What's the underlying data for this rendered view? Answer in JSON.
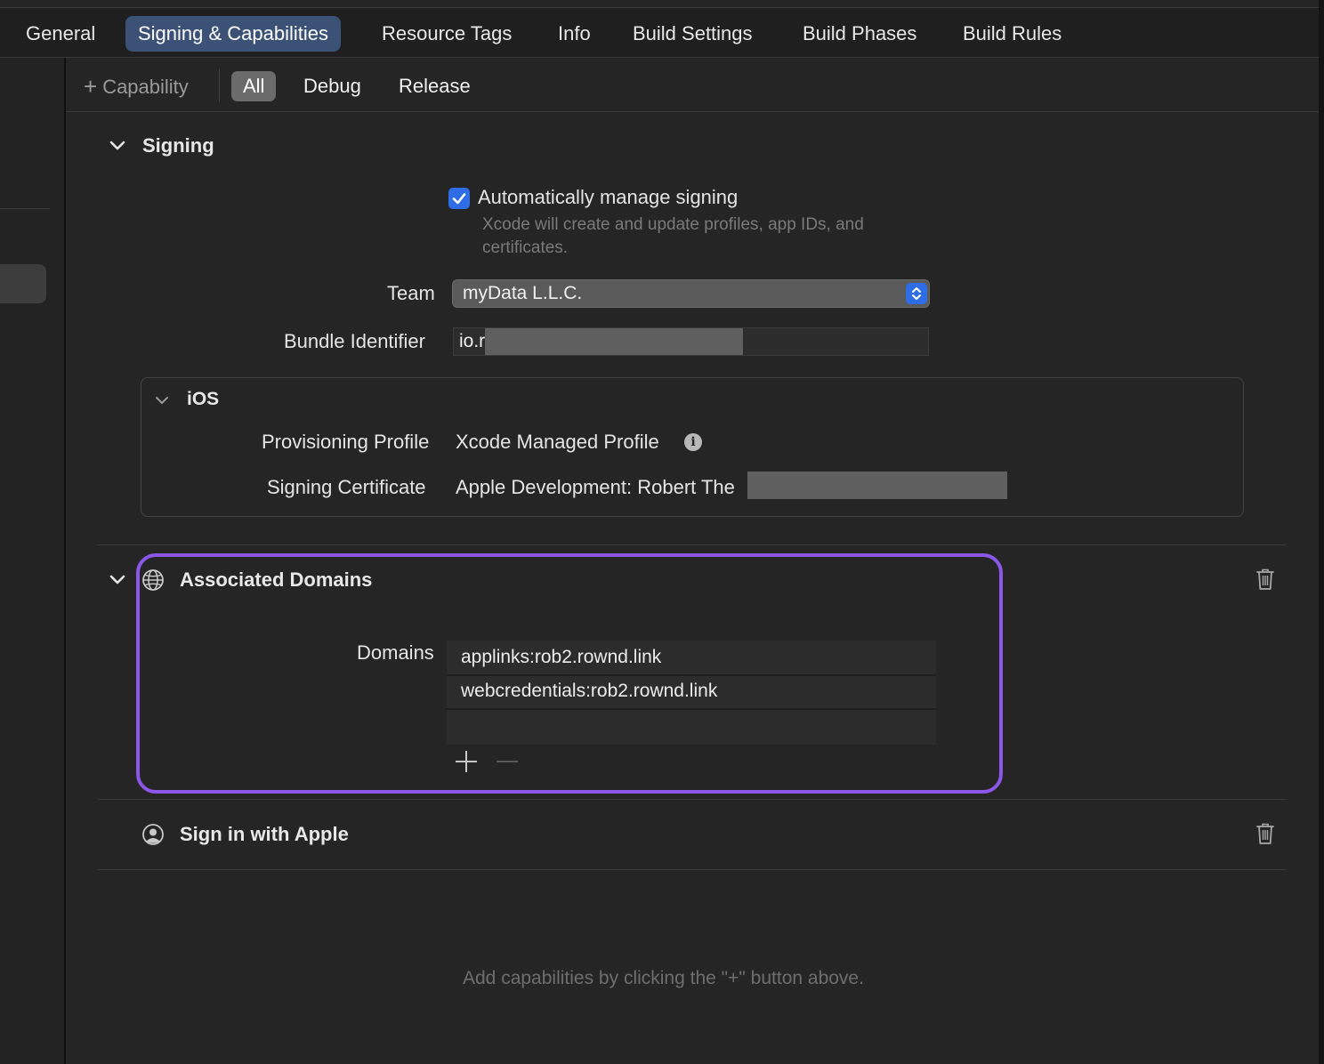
{
  "tabs": [
    "General",
    "Signing & Capabilities",
    "Resource Tags",
    "Info",
    "Build Settings",
    "Build Phases",
    "Build Rules"
  ],
  "toolbar": {
    "capability_label": "Capability",
    "filters": [
      "All",
      "Debug",
      "Release"
    ]
  },
  "signing": {
    "title": "Signing",
    "auto_manage_label": "Automatically manage signing",
    "auto_manage_checked": true,
    "auto_manage_hint": "Xcode will create and update profiles, app IDs, and certificates.",
    "team_label": "Team",
    "team_value": "myData L.L.C.",
    "bundle_label": "Bundle Identifier",
    "bundle_value": "io.r",
    "ios": {
      "title": "iOS",
      "provisioning_label": "Provisioning Profile",
      "provisioning_value": "Xcode Managed Profile",
      "certificate_label": "Signing Certificate",
      "certificate_value": "Apple Development: Robert The"
    }
  },
  "associated_domains": {
    "title": "Associated Domains",
    "domains_label": "Domains",
    "domains": [
      "applinks:rob2.rownd.link",
      "webcredentials:rob2.rownd.link"
    ],
    "add_button": "+",
    "remove_button": "−"
  },
  "sign_in_with_apple": {
    "title": "Sign in with Apple"
  },
  "footer_hint": "Add capabilities by clicking the \"+\" button above.",
  "colors": {
    "accent": "#2f6de6",
    "highlight": "#8a57e8",
    "selected_tab": "#3b5176",
    "background": "#252525"
  }
}
